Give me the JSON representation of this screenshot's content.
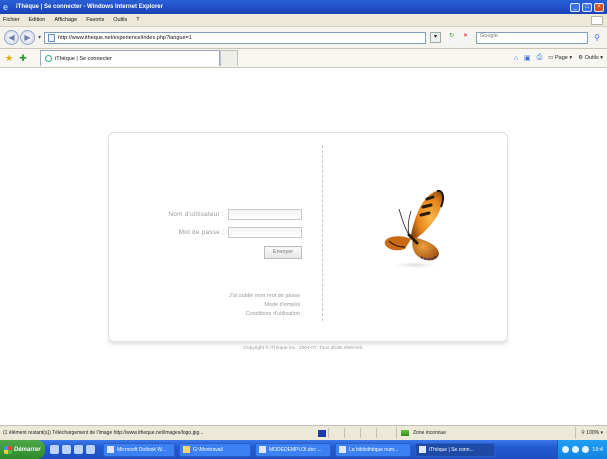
{
  "window": {
    "title": "iThèque | Se connecter - Windows Internet Explorer"
  },
  "menu": {
    "items": [
      "Fichier",
      "Edition",
      "Affichage",
      "Favoris",
      "Outils",
      "?"
    ]
  },
  "address": {
    "url": "http://www.itheque.net/experience/index.php?langue=1",
    "search_placeholder": "Google"
  },
  "tab": {
    "label": "iThèque | Se connecter"
  },
  "commands": {
    "page": "Page",
    "tools": "Outils"
  },
  "login": {
    "username_label": "Nom d'utilisateur :",
    "password_label": "Mot de passe :",
    "submit_label": "Envoyer",
    "forgot_link": "J'ai oublié mon mot de passe",
    "help_link": "Mode d'emploi",
    "terms_link": "Conditions d'utilisation"
  },
  "footer": {
    "copyright": "Copyright © iThèque inc., 2004-07. Tous droits réservés."
  },
  "status": {
    "text": "(1 élément restant(s)) Téléchargement de l'image http://www.itheque.net/images/logo.jpg...",
    "zone": "Zone inconnue",
    "zoom": "100%"
  },
  "taskbar": {
    "start": "Démarrer",
    "tasks": [
      "Microsoft Outlook W...",
      "G:\\Montravail",
      "MODEDEMPLOI.doc ...",
      "La bibliothèque num...",
      "iThèque | Se conn..."
    ],
    "clock": "19:4"
  }
}
